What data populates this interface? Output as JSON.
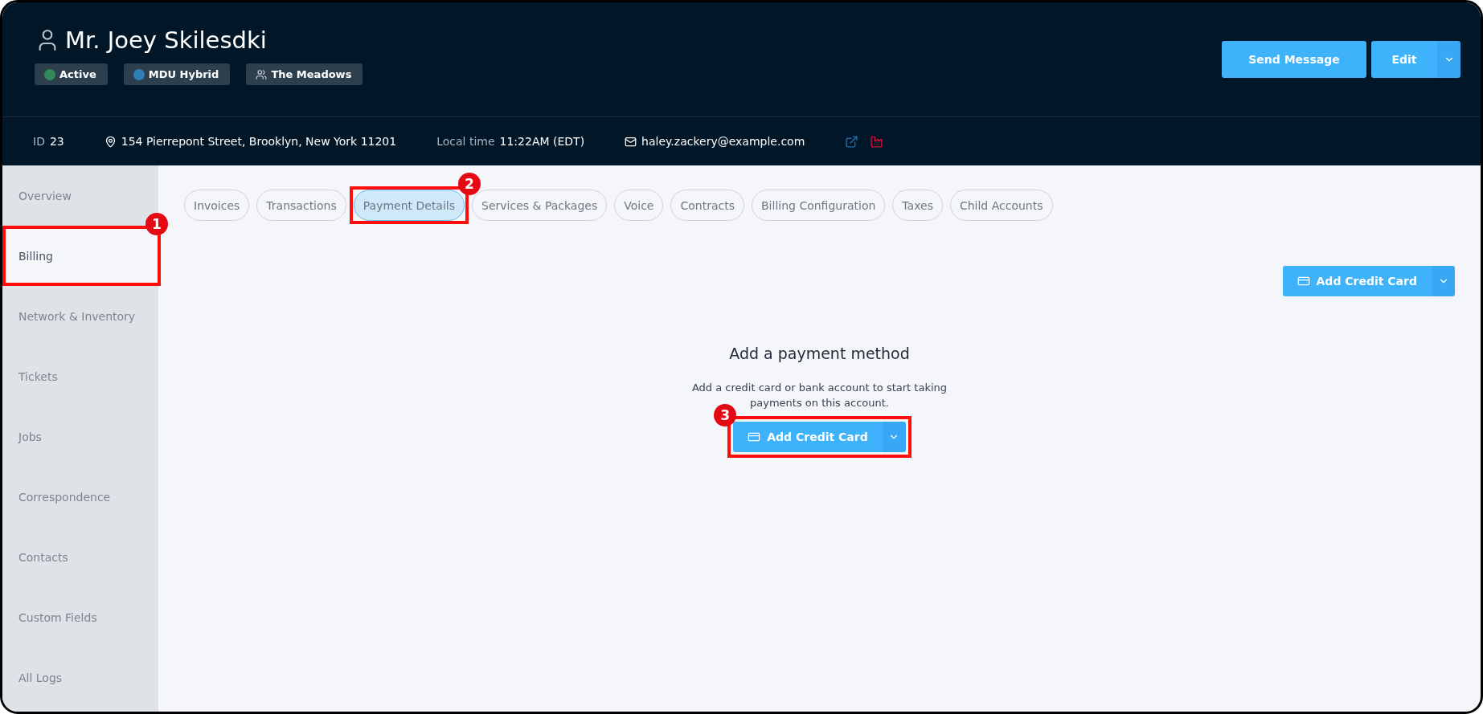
{
  "customer": {
    "name": "Mr. Joey Skilesdki",
    "badges": [
      {
        "kind": "dot",
        "label": "Active",
        "color": "#2e8b57"
      },
      {
        "kind": "dot",
        "label": "MDU Hybrid",
        "color": "#2f7fb8"
      },
      {
        "kind": "group",
        "label": "The Meadows"
      }
    ]
  },
  "header_actions": {
    "primary": "Send Message",
    "edit": "Edit"
  },
  "info_bar": {
    "id_label": "ID",
    "id_value": "23",
    "address": "154 Pierrepont Street, Brooklyn, New York 11201",
    "time_label": "Local time",
    "time_value": "11:22AM (EDT)",
    "email": "haley.zackery@example.com"
  },
  "sidebar": {
    "items": [
      {
        "label": "Overview",
        "selected": false
      },
      {
        "label": "Billing",
        "selected": true,
        "callout": "1"
      },
      {
        "label": "Network & Inventory",
        "selected": false
      },
      {
        "label": "Tickets",
        "selected": false
      },
      {
        "label": "Jobs",
        "selected": false
      },
      {
        "label": "Correspondence",
        "selected": false
      },
      {
        "label": "Contacts",
        "selected": false
      },
      {
        "label": "Custom Fields",
        "selected": false
      },
      {
        "label": "All Logs",
        "selected": false
      }
    ]
  },
  "tabs": [
    {
      "label": "Invoices",
      "selected": false
    },
    {
      "label": "Transactions",
      "selected": false
    },
    {
      "label": "Payment Details",
      "selected": true,
      "callout": "2"
    },
    {
      "label": "Services & Packages",
      "selected": false
    },
    {
      "label": "Voice",
      "selected": false
    },
    {
      "label": "Contracts",
      "selected": false
    },
    {
      "label": "Billing Configuration",
      "selected": false
    },
    {
      "label": "Taxes",
      "selected": false
    },
    {
      "label": "Child Accounts",
      "selected": false
    }
  ],
  "toolbar_button": {
    "label": "Add Credit Card"
  },
  "empty_state": {
    "title": "Add a payment method",
    "text": "Add a credit card or bank account to start taking payments on this account.",
    "button": {
      "label": "Add Credit Card",
      "callout": "3"
    }
  }
}
